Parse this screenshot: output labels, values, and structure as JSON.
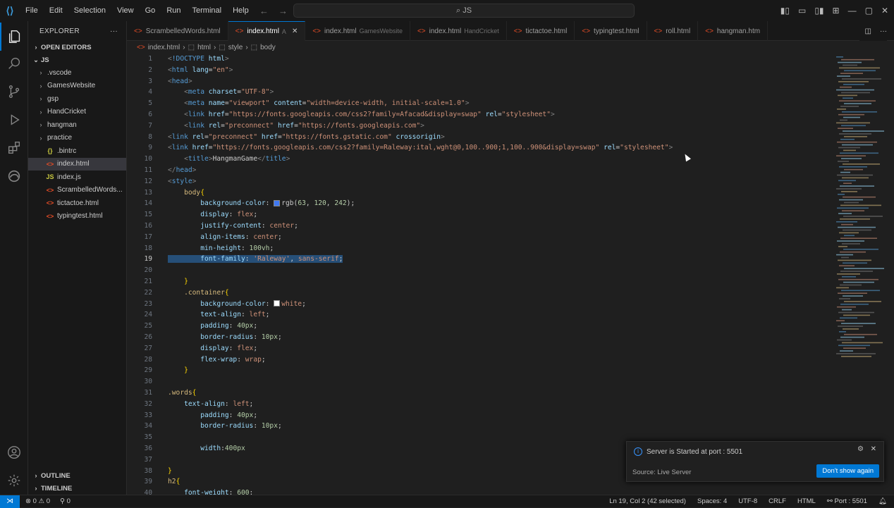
{
  "menu": [
    "File",
    "Edit",
    "Selection",
    "View",
    "Go",
    "Run",
    "Terminal",
    "Help"
  ],
  "search_text": "JS",
  "sidebar": {
    "title": "EXPLORER",
    "open_editors": "OPEN EDITORS",
    "root": "JS",
    "items": [
      {
        "label": ".vscode",
        "type": "folder"
      },
      {
        "label": "GamesWebsite",
        "type": "folder"
      },
      {
        "label": "gsp",
        "type": "folder"
      },
      {
        "label": "HandCricket",
        "type": "folder"
      },
      {
        "label": "hangman",
        "type": "folder"
      },
      {
        "label": "practice",
        "type": "folder"
      },
      {
        "label": ".bintrc",
        "type": "file",
        "icon": "{}"
      },
      {
        "label": "index.html",
        "type": "file",
        "icon": "<>",
        "selected": true
      },
      {
        "label": "index.js",
        "type": "file",
        "icon": "JS"
      },
      {
        "label": "ScrambelledWords...",
        "type": "file",
        "icon": "<>"
      },
      {
        "label": "tictactoe.html",
        "type": "file",
        "icon": "<>"
      },
      {
        "label": "typingtest.html",
        "type": "file",
        "icon": "<>"
      }
    ],
    "outline": "OUTLINE",
    "timeline": "TIMELINE"
  },
  "tabs": [
    {
      "label": "ScrambelledWords.html",
      "desc": ""
    },
    {
      "label": "index.html",
      "desc": "",
      "active": true,
      "flag": "A"
    },
    {
      "label": "index.html",
      "desc": "GamesWebsite"
    },
    {
      "label": "index.html",
      "desc": "HandCricket"
    },
    {
      "label": "tictactoe.html",
      "desc": ""
    },
    {
      "label": "typingtest.html",
      "desc": ""
    },
    {
      "label": "roll.html",
      "desc": ""
    },
    {
      "label": "hangman.htm",
      "desc": ""
    }
  ],
  "breadcrumb": [
    "index.html",
    "html",
    "style",
    "body"
  ],
  "code_lines": [
    {
      "n": "1",
      "html": "<span class='t-punc'>&lt;</span><span class='t-tag'>!DOCTYPE</span> <span class='t-attr'>html</span><span class='t-punc'>&gt;</span>"
    },
    {
      "n": "2",
      "html": "<span class='t-punc'>&lt;</span><span class='t-tag'>html</span> <span class='t-attr'>lang</span>=<span class='t-str'>\"en\"</span><span class='t-punc'>&gt;</span>"
    },
    {
      "n": "3",
      "html": "<span class='t-punc'>&lt;</span><span class='t-tag'>head</span><span class='t-punc'>&gt;</span>"
    },
    {
      "n": "4",
      "html": "    <span class='t-punc'>&lt;</span><span class='t-tag'>meta</span> <span class='t-attr'>charset</span>=<span class='t-str'>\"UTF-8\"</span><span class='t-punc'>&gt;</span>"
    },
    {
      "n": "5",
      "html": "    <span class='t-punc'>&lt;</span><span class='t-tag'>meta</span> <span class='t-attr'>name</span>=<span class='t-str'>\"viewport\"</span> <span class='t-attr'>content</span>=<span class='t-str'>\"width=device-width, initial-scale=1.0\"</span><span class='t-punc'>&gt;</span>"
    },
    {
      "n": "6",
      "html": "    <span class='t-punc'>&lt;</span><span class='t-tag'>link</span> <span class='t-attr'>href</span>=<span class='t-str'>\"https://fonts.googleapis.com/css2?family=Afacad&amp;display=swap\"</span> <span class='t-attr'>rel</span>=<span class='t-str'>\"stylesheet\"</span><span class='t-punc'>&gt;</span>"
    },
    {
      "n": "7",
      "html": "    <span class='t-punc'>&lt;</span><span class='t-tag'>link</span> <span class='t-attr'>rel</span>=<span class='t-str'>\"preconnect\"</span> <span class='t-attr'>href</span>=<span class='t-str'>\"https://fonts.googleapis.com\"</span><span class='t-punc'>&gt;</span>"
    },
    {
      "n": "8",
      "html": "<span class='t-punc'>&lt;</span><span class='t-tag'>link</span> <span class='t-attr'>rel</span>=<span class='t-str'>\"preconnect\"</span> <span class='t-attr'>href</span>=<span class='t-str'>\"https://fonts.gstatic.com\"</span> <span class='t-attr'>crossorigin</span><span class='t-punc'>&gt;</span>"
    },
    {
      "n": "9",
      "html": "<span class='t-punc'>&lt;</span><span class='t-tag'>link</span> <span class='t-attr'>href</span>=<span class='t-str'>\"https://fonts.googleapis.com/css2?family=Raleway:ital,wght@0,100..900;1,100..900&amp;display=swap\"</span> <span class='t-attr'>rel</span>=<span class='t-str'>\"stylesheet\"</span><span class='t-punc'>&gt;</span>"
    },
    {
      "n": "10",
      "html": "    <span class='t-punc'>&lt;</span><span class='t-tag'>title</span><span class='t-punc'>&gt;</span><span class='t-txt'>HangmanGame</span><span class='t-punc'>&lt;/</span><span class='t-tag'>title</span><span class='t-punc'>&gt;</span>"
    },
    {
      "n": "11",
      "html": "<span class='t-punc'>&lt;/</span><span class='t-tag'>head</span><span class='t-punc'>&gt;</span>"
    },
    {
      "n": "12",
      "html": "<span class='t-punc'>&lt;</span><span class='t-tag'>style</span><span class='t-punc'>&gt;</span>"
    },
    {
      "n": "13",
      "html": "    <span class='t-sel'>body</span><span class='t-brk'>{</span>"
    },
    {
      "n": "14",
      "html": "        <span class='t-prop'>background-color</span>: <span class='swatch' style='background:rgb(63,120,242)'></span><span class='t-txt'>rgb(</span><span class='t-num'>63</span>, <span class='t-num'>120</span>, <span class='t-num'>242</span><span class='t-txt'>)</span>;"
    },
    {
      "n": "15",
      "html": "        <span class='t-prop'>display</span>: <span class='t-val'>flex</span>;"
    },
    {
      "n": "16",
      "html": "        <span class='t-prop'>justify-content</span>: <span class='t-val'>center</span>;"
    },
    {
      "n": "17",
      "html": "        <span class='t-prop'>align-items</span>: <span class='t-val'>center</span>;"
    },
    {
      "n": "18",
      "html": "        <span class='t-prop'>min-height</span>: <span class='t-num'>100vh</span>;"
    },
    {
      "n": "19",
      "html": "<span class='hl'>        <span class='t-prop'>font-family</span>: <span class='t-str'>'Raleway'</span>, <span class='t-val'>sans-serif</span>;</span>",
      "current": true
    },
    {
      "n": "20",
      "html": ""
    },
    {
      "n": "21",
      "html": "    <span class='t-brk'>}</span>"
    },
    {
      "n": "22",
      "html": "    <span class='t-sel'>.container</span><span class='t-brk'>{</span>"
    },
    {
      "n": "23",
      "html": "        <span class='t-prop'>background-color</span>: <span class='swatch' style='background:#ffffff'></span><span class='t-val'>white</span>;"
    },
    {
      "n": "24",
      "html": "        <span class='t-prop'>text-align</span>: <span class='t-val'>left</span>;"
    },
    {
      "n": "25",
      "html": "        <span class='t-prop'>padding</span>: <span class='t-num'>40px</span>;"
    },
    {
      "n": "26",
      "html": "        <span class='t-prop'>border-radius</span>: <span class='t-num'>10px</span>;"
    },
    {
      "n": "27",
      "html": "        <span class='t-prop'>display</span>: <span class='t-val'>flex</span>;"
    },
    {
      "n": "28",
      "html": "        <span class='t-prop'>flex-wrap</span>: <span class='t-val'>wrap</span>;"
    },
    {
      "n": "29",
      "html": "    <span class='t-brk'>}</span>"
    },
    {
      "n": "30",
      "html": ""
    },
    {
      "n": "31",
      "html": "<span class='t-sel'>.words</span><span class='t-brk'>{</span>"
    },
    {
      "n": "32",
      "html": "    <span class='t-prop'>text-align</span>: <span class='t-val'>left</span>;"
    },
    {
      "n": "33",
      "html": "        <span class='t-prop'>padding</span>: <span class='t-num'>40px</span>;"
    },
    {
      "n": "34",
      "html": "        <span class='t-prop'>border-radius</span>: <span class='t-num'>10px</span>;"
    },
    {
      "n": "35",
      "html": ""
    },
    {
      "n": "36",
      "html": "        <span class='t-prop'>width</span>:<span class='t-num'>400px</span>"
    },
    {
      "n": "37",
      "html": ""
    },
    {
      "n": "38",
      "html": "<span class='t-brk'>}</span>"
    },
    {
      "n": "39",
      "html": "<span class='t-sel'>h2</span><span class='t-brk'>{</span>"
    },
    {
      "n": "40",
      "html": "    <span class='t-prop'>font-weight</span>: <span class='t-num'>600</span>;"
    }
  ],
  "toast": {
    "message": "Server is Started at port : 5501",
    "source": "Source: Live Server",
    "button": "Don't show again"
  },
  "status": {
    "errors": "0",
    "warnings": "0",
    "ports": "0",
    "position": "Ln 19, Col 2 (42 selected)",
    "spaces": "Spaces: 4",
    "encoding": "UTF-8",
    "eol": "CRLF",
    "language": "HTML",
    "port": "Port : 5501"
  },
  "colors": {
    "accent": "#0078d4"
  }
}
